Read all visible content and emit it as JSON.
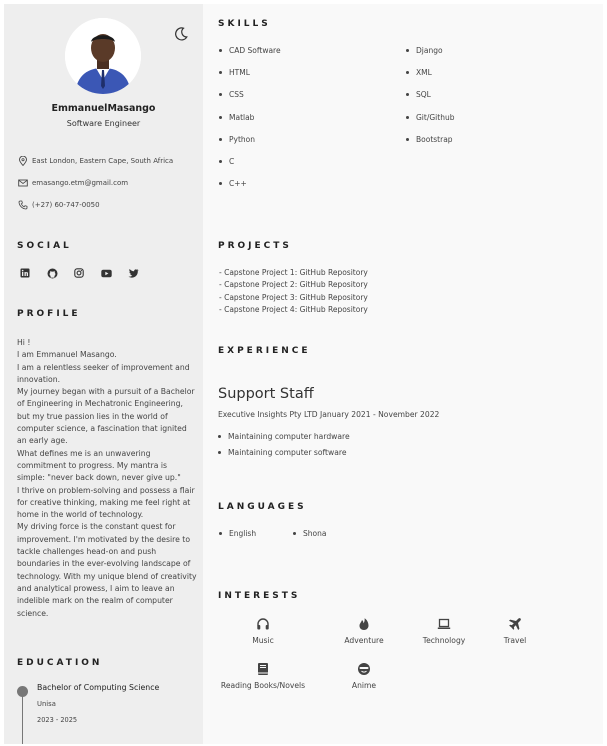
{
  "header": {
    "name": "EmmanuelMasango",
    "title": "Software Engineer",
    "theme_icon": "moon-icon"
  },
  "contact": {
    "location": "East London, Eastern Cape, South Africa",
    "email": "emasango.etm@gmail.com",
    "phone": "(+27) 60-747-0050"
  },
  "social": {
    "heading": "SOCIAL",
    "icons": [
      "linkedin-icon",
      "github-icon",
      "instagram-icon",
      "youtube-icon",
      "twitter-icon"
    ]
  },
  "profile": {
    "heading": "PROFILE",
    "lines": [
      "Hi !",
      "I am Emmanuel Masango.",
      "I am a relentless seeker of improvement and innovation.",
      "My journey began with a pursuit of a Bachelor of Engineering in Mechatronic Engineering,",
      "but my true passion lies in the world of computer science, a fascination that ignited an early age.",
      "What defines me is an unwavering commitment to progress. My mantra is simple: \"never back down, never give up.\"",
      "I thrive on problem-solving and possess a flair for creative thinking, making me feel right at home in the world of technology.",
      "My driving force is the constant quest for improvement. I'm motivated by the desire to tackle challenges head-on and push boundaries in the ever-evolving landscape of technology. With my unique blend of creativity and analytical prowess, I aim to leave an indelible mark on the realm of computer science."
    ]
  },
  "education": {
    "heading": "EDUCATION",
    "degree": "Bachelor of Computing Science",
    "school": "Unisa",
    "years": "2023 - 2025"
  },
  "skills": {
    "heading": "SKILLS",
    "col1": [
      "CAD Software",
      "HTML",
      "CSS",
      "Matlab",
      "Python",
      "C",
      "C++"
    ],
    "col2": [
      "Django",
      "XML",
      "SQL",
      "Git/Github",
      "Bootstrap"
    ]
  },
  "projects": {
    "heading": "PROJECTS",
    "items": [
      "- Capstone Project 1: GitHub Repository",
      "- Capstone Project 2: GitHub Repository",
      "- Capstone Project 3: GitHub Repository",
      "- Capstone Project 4: GitHub Repository"
    ]
  },
  "experience": {
    "heading": "EXPERIENCE",
    "role": "Support Staff",
    "company_dates": "Executive Insights Pty LTD January 2021 - November 2022",
    "duties": [
      "Maintaining computer hardware",
      "Maintaining computer software"
    ]
  },
  "languages": {
    "heading": "LANGUAGES",
    "items": [
      "English",
      "Shona"
    ]
  },
  "interests": {
    "heading": "INTERESTS",
    "items": [
      {
        "label": "Music",
        "icon": "headphones-icon"
      },
      {
        "label": "Adventure",
        "icon": "fire-icon"
      },
      {
        "label": "Technology",
        "icon": "laptop-icon"
      },
      {
        "label": "Travel",
        "icon": "plane-icon"
      },
      {
        "label": "Reading Books/Novels",
        "icon": "book-icon"
      },
      {
        "label": "Anime",
        "icon": "face-icon"
      }
    ]
  }
}
